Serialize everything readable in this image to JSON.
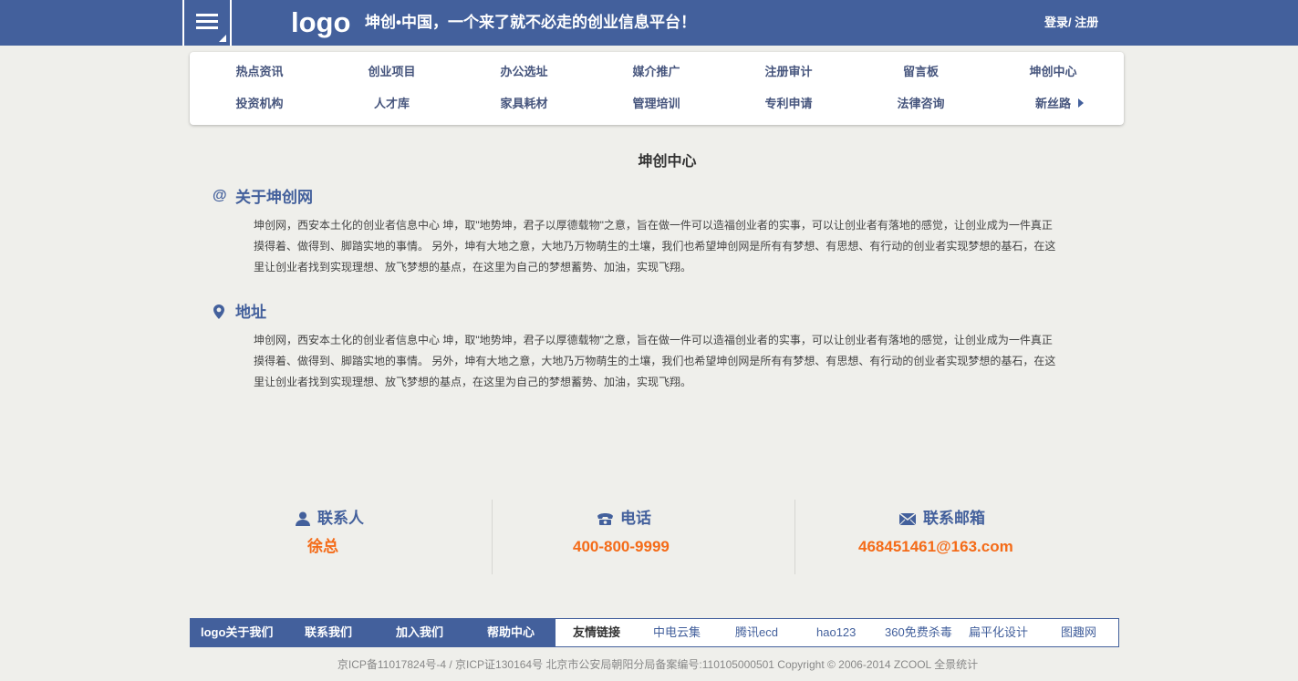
{
  "header": {
    "logo": "logo",
    "slogan": "坤创•中国，一个来了就不必走的创业信息平台！",
    "login": "登录/",
    "register": "注册"
  },
  "nav": {
    "row1": [
      "热点资讯",
      "创业项目",
      "办公选址",
      "媒介推广",
      "注册审计",
      "留言板",
      "坤创中心"
    ],
    "row2": [
      "投资机构",
      "人才库",
      "家具耗材",
      "管理培训",
      "专利申请",
      "法律咨询",
      "新丝路"
    ]
  },
  "main": {
    "title": "坤创中心",
    "sections": [
      {
        "icon": "at-icon",
        "heading": "关于坤创网",
        "text": "坤创网，西安本土化的创业者信息中心 坤，取\"地势坤，君子以厚德载物\"之意，旨在做一件可以造福创业者的实事，可以让创业者有落地的感觉，让创业成为一件真正摸得着、做得到、脚踏实地的事情。 另外，坤有大地之意，大地乃万物萌生的土壤，我们也希望坤创网是所有有梦想、有思想、有行动的创业者实现梦想的基石，在这里让创业者找到实现理想、放飞梦想的基点，在这里为自己的梦想蓄势、加油，实现飞翔。"
      },
      {
        "icon": "map-pin-icon",
        "heading": "地址",
        "text": "坤创网，西安本土化的创业者信息中心 坤，取\"地势坤，君子以厚德载物\"之意，旨在做一件可以造福创业者的实事，可以让创业者有落地的感觉，让创业成为一件真正摸得着、做得到、脚踏实地的事情。 另外，坤有大地之意，大地乃万物萌生的土壤，我们也希望坤创网是所有有梦想、有思想、有行动的创业者实现梦想的基石，在这里让创业者找到实现理想、放飞梦想的基点，在这里为自己的梦想蓄势、加油，实现飞翔。"
      }
    ]
  },
  "contact": {
    "person_label": "联系人",
    "person_value": "徐总",
    "phone_label": "电话",
    "phone_value": "400-800-9999",
    "email_label": "联系邮箱",
    "email_value": "468451461@163.com",
    "accent": "#f46b18"
  },
  "footer": {
    "left": [
      "logo关于我们",
      "联系我们",
      "加入我们",
      "帮助中心"
    ],
    "links_label": "友情链接",
    "links": [
      "中电云集",
      "腾讯ecd",
      "hao123",
      "360免费杀毒",
      "扁平化设计",
      "图趣网"
    ],
    "copyright": "京ICP备11017824号-4 / 京ICP证130164号 北京市公安局朝阳分局备案编号:110105000501 Copyright © 2006-2014 ZCOOL 全景统计"
  },
  "colors": {
    "brand": "#43609c",
    "background": "#efefeb"
  }
}
